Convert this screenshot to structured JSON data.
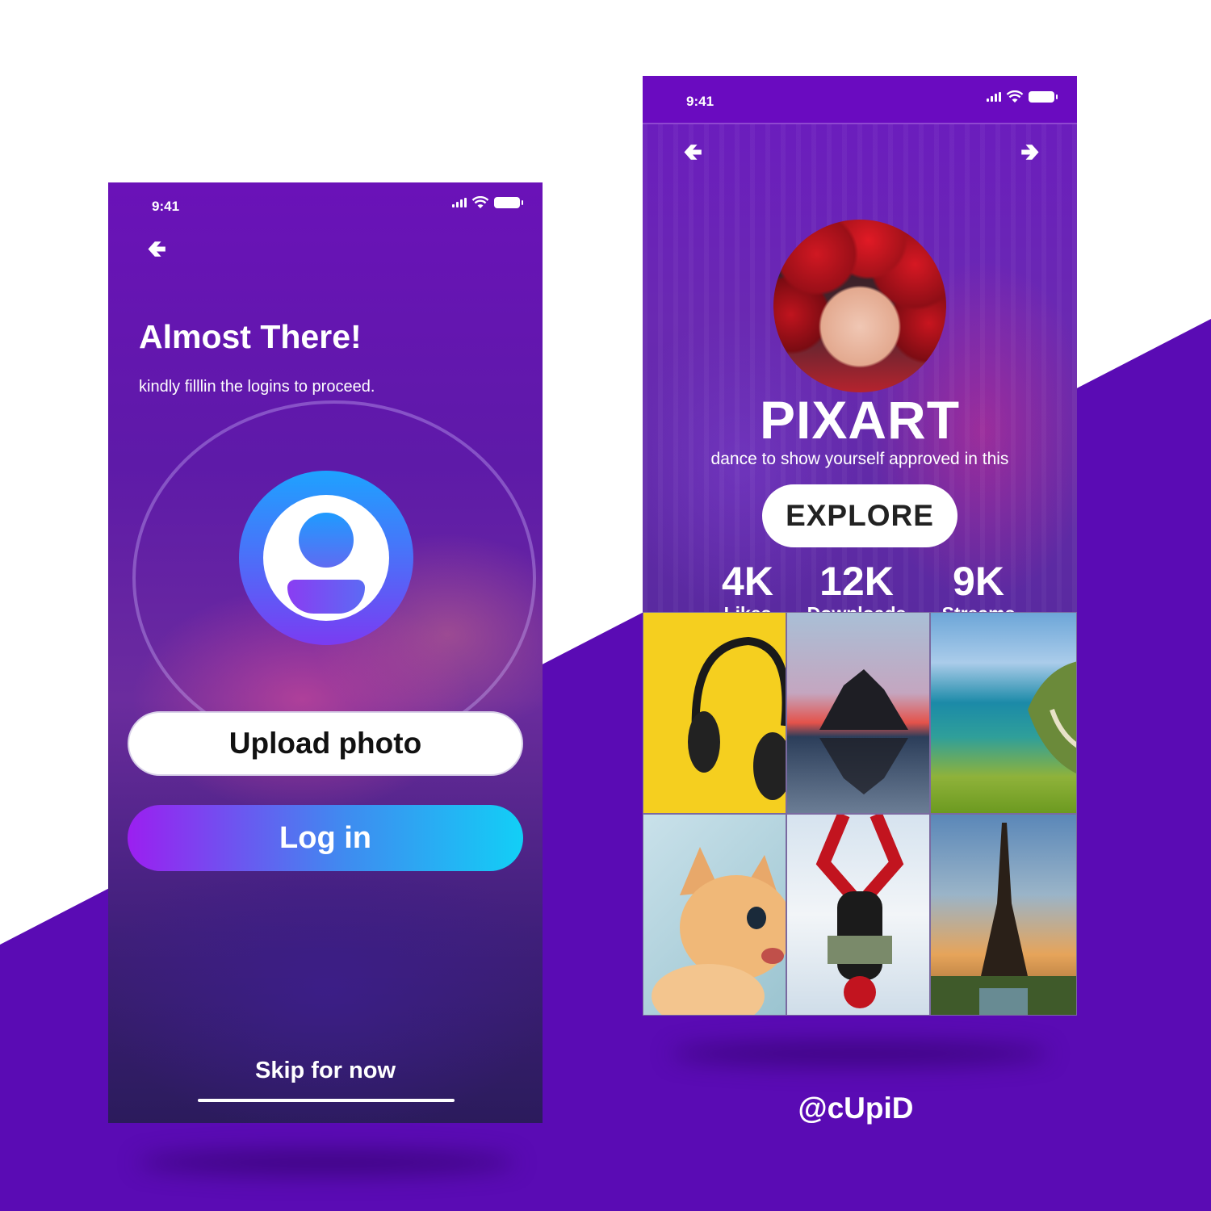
{
  "login_screen": {
    "status_time": "9:41",
    "title": "Almost There!",
    "subtitle": "kindly filllin the logins to proceed.",
    "upload_label": "Upload photo",
    "login_label": "Log in",
    "skip_label": "Skip for now"
  },
  "profile_screen": {
    "status_time": "9:41",
    "brand": "PIXART",
    "tagline": "dance to show yourself approved in this",
    "explore_label": "EXPLORE",
    "stats": [
      {
        "value": "4K",
        "label": "Likes"
      },
      {
        "value": "12K",
        "label": "Downloads"
      },
      {
        "value": "9K",
        "label": "Streams"
      }
    ],
    "gallery": [
      "headphones",
      "sea-stack",
      "coastline",
      "kitten",
      "spider-man",
      "eiffel-tower"
    ]
  },
  "credit": "@cUpiD",
  "colors": {
    "accent_purple": "#5a0bb4",
    "login_gradient_start": "#9b1ff0",
    "login_gradient_end": "#12cff6"
  },
  "icons": [
    "back-arrow-icon",
    "forward-arrow-icon",
    "signal-icon",
    "wifi-icon",
    "battery-icon",
    "user-avatar-icon"
  ]
}
